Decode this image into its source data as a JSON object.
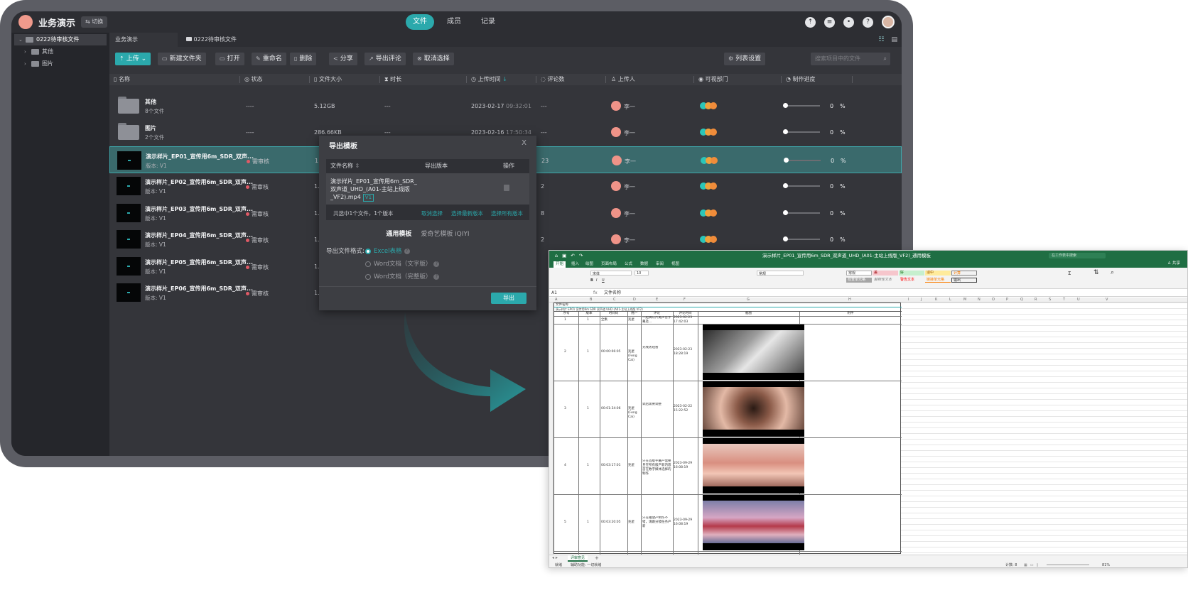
{
  "app": {
    "title": "业务演示",
    "switch_label": "⇆ 切换",
    "nav_tabs": [
      "文件",
      "成员",
      "记录"
    ],
    "active_tab": "文件"
  },
  "sidebar": {
    "root": "0222待审核文件",
    "children": [
      "其他",
      "图片"
    ]
  },
  "breadcrumb": [
    "业务演示",
    "0222待审核文件"
  ],
  "toolbar": {
    "upload": "上传",
    "new_folder": "新建文件夹",
    "open": "打开",
    "rename": "重命名",
    "delete": "删除",
    "share": "分享",
    "export_comments": "导出评论",
    "cancel_selection": "取消选择",
    "list_settings": "列表设置",
    "search_placeholder": "搜索项目中的文件"
  },
  "columns": [
    "名称",
    "状态",
    "文件大小",
    "时长",
    "上传时间",
    "评论数",
    "上传人",
    "可视部门",
    "制作进度"
  ],
  "rows": [
    {
      "kind": "folder",
      "name": "其他",
      "sub": "8个文件",
      "status": "----",
      "size": "5.12GB",
      "duration": "---",
      "date": "2023-02-17",
      "time": "09:32:01",
      "comments": "---",
      "uploader": "李一",
      "progress": "0",
      "pct": "%"
    },
    {
      "kind": "folder",
      "name": "图片",
      "sub": "2个文件",
      "status": "----",
      "size": "286.66KB",
      "duration": "---",
      "date": "2023-02-16",
      "time": "17:50:34",
      "comments": "---",
      "uploader": "李一",
      "progress": "0",
      "pct": "%"
    },
    {
      "kind": "video",
      "name": "演示样片_EP01_宣传用6m_SDR_双声...",
      "sub": "版本: V1",
      "status": "需审核",
      "size": "1.65GB",
      "comments": "23",
      "uploader": "李一",
      "progress": "0",
      "pct": "%"
    },
    {
      "kind": "video",
      "name": "演示样片_EP02_宣传用6m_SDR_双声...",
      "sub": "版本: V1",
      "status": "需审核",
      "size": "1.65GB",
      "comments": "2",
      "uploader": "李一",
      "progress": "0",
      "pct": "%"
    },
    {
      "kind": "video",
      "name": "演示样片_EP03_宣传用6m_SDR_双声...",
      "sub": "版本: V1",
      "status": "需审核",
      "size": "1.65GB",
      "comments": "8",
      "uploader": "李一",
      "progress": "0",
      "pct": "%"
    },
    {
      "kind": "video",
      "name": "演示样片_EP04_宣传用6m_SDR_双声...",
      "sub": "版本: V1",
      "status": "需审核",
      "size": "1.55GB",
      "comments": "2",
      "uploader": "李一",
      "progress": "0",
      "pct": "%"
    },
    {
      "kind": "video",
      "name": "演示样片_EP05_宣传用6m_SDR_双声...",
      "sub": "版本: V1",
      "status": "需审核",
      "size": "1.65GB"
    },
    {
      "kind": "video",
      "name": "演示样片_EP06_宣传用6m_SDR_双声...",
      "sub": "版本: V1",
      "status": "需审核",
      "size": "1.65GB"
    }
  ],
  "dept_colors": [
    "#2bc6b8",
    "#f0a23c",
    "#f08c3a"
  ],
  "modal": {
    "title": "导出模板",
    "close": "X",
    "col_file": "文件名称",
    "col_version": "导出版本",
    "col_action": "操作",
    "file_name": "演示样片_EP01_宣传用6m_SDR_双声道_UHD_(A01-主站上线版_VF2).mp4",
    "version_tag": "V1",
    "summary": "共选中1个文件，1个版本",
    "cancel_select": "取消选择",
    "select_latest": "选择最新版本",
    "select_all": "选择所有版本",
    "tab_general": "通用模板",
    "tab_iqiyi": "爱奇艺模板 iQIYI",
    "format_label": "导出文件格式:",
    "opt_excel": "Excel表格",
    "opt_word_text": "Word文档（文字版）",
    "opt_word_full": "Word文档（完整版）",
    "export": "导出"
  },
  "excel": {
    "title": "演示样片_EP01_宣传用6m_SDR_双声道_UHD_(A01-主站上线版_VF2)_通用模板",
    "search": "在工作表中搜索",
    "tabs": [
      "开始",
      "插入",
      "绘图",
      "页面布局",
      "公式",
      "数据",
      "审阅",
      "视图"
    ],
    "share": "共享",
    "cell_ref": "A1",
    "formula": "文件名称",
    "font": "宋体",
    "font_size": "10",
    "number_format": "常规",
    "styles": [
      "常规",
      "差",
      "好",
      "适中",
      "计算",
      "检查单元格",
      "解释性文本",
      "警告文本",
      "链接单元格",
      "输出"
    ],
    "cols": [
      "A",
      "B",
      "C",
      "D",
      "E",
      "F",
      "G",
      "H",
      "I",
      "J",
      "K",
      "L",
      "M",
      "N",
      "O",
      "P",
      "Q",
      "R",
      "S",
      "T",
      "U",
      "V"
    ],
    "sheet_title": "文件名称",
    "sheet_sub": "演示样片 EP01 宣传用6m SDR 双声道 UHD (A01-主站上线版 VF2)",
    "headers": [
      "序号",
      "版本",
      "时间码",
      "用户",
      "评论",
      "评论时间",
      "截图",
      "附件"
    ],
    "comments": [
      {
        "no": "1",
        "ver": "1",
        "tc": "全集",
        "user": "兆星",
        "text": "一起确认片尾声音字幕及...",
        "time": "2023-02-23 17:42:03"
      },
      {
        "no": "2",
        "ver": "1",
        "tc": "00:00:06:05",
        "user": "兆星 (Feng Cai)",
        "text": "光线太短暂",
        "time": "2023-02-23 18:28:19"
      },
      {
        "no": "3",
        "ver": "1",
        "tc": "00:01:34:06",
        "user": "兆星 (Feng Cai)",
        "text": "调后需要调整",
        "time": "2023-02-22 15:22:52"
      },
      {
        "no": "4",
        "ver": "1",
        "tc": "00:03:17:01",
        "user": "兆星",
        "text": "只在首版字幕产需要且在所有版产新内容首在数字媒体选择的制作",
        "time": "2023-09-29 16:08:19"
      },
      {
        "no": "5",
        "ver": "1",
        "tc": "00:03:20:05",
        "user": "兆星",
        "text": "只在播放产制作不错，请跟分镜任务产新",
        "time": "2023-09-29 16:08:19"
      }
    ],
    "sheet_tab": "评审意见",
    "status_left": "就绪",
    "status_access": "辅助功能: 一切就绪",
    "status_count": "计数: 8",
    "zoom": "81%"
  }
}
